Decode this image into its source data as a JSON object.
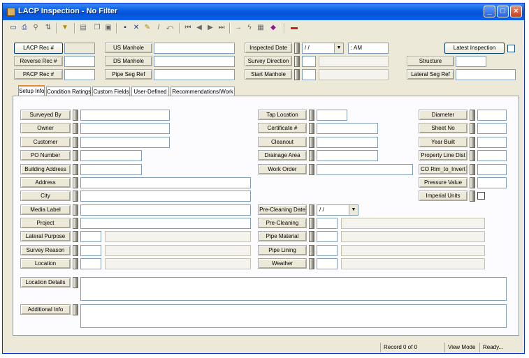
{
  "window": {
    "title": "LACP Inspection - No Filter"
  },
  "toolbar_icons": [
    "form-view-icon",
    "print-icon",
    "binoculars-icon",
    "sort-icon",
    "filter-icon",
    "report-icon",
    "copy-icon",
    "save-icon",
    "delete-icon",
    "edit-icon",
    "pencil-icon",
    "undo-icon",
    "first-record-icon",
    "prev-record-icon",
    "next-record-icon",
    "last-record-icon",
    "new-record-icon",
    "lightning-icon",
    "calculator-icon",
    "book-icon",
    "exit-icon"
  ],
  "header": {
    "lacp_rec": "LACP Rec #",
    "reverse_rec": "Reverse Rec #",
    "pacp_rec": "PACP Rec #",
    "us_manhole": "US Manhole",
    "ds_manhole": "DS Manhole",
    "pipe_seg_ref": "Pipe Seg Ref",
    "inspected_date": "Inspected Date",
    "inspected_date_value": "/ /",
    "inspected_time_value": ":  AM",
    "survey_direction": "Survey Direction",
    "start_manhole": "Start Manhole",
    "latest_inspection": "Latest Inspection",
    "structure": "Structure",
    "lateral_seg_ref": "Lateral Seg Ref"
  },
  "tabs": [
    "Setup Info",
    "Condition Ratings",
    "Custom Fields",
    "User-Defined",
    "Recommendations/Work"
  ],
  "left_fields": [
    "Surveyed By",
    "Owner",
    "Customer",
    "PO Number",
    "Building Address",
    "Address",
    "City",
    "Media Label",
    "Project",
    "Lateral Purpose",
    "Survey Reason",
    "Location"
  ],
  "mid_fields": [
    "Tap Location",
    "Certificate #",
    "Cleanout",
    "Drainage Area",
    "Work Order",
    "Pre-Cleaning Date",
    "Pre-Cleaning",
    "Pipe Material",
    "Pipe Lining",
    "Weather"
  ],
  "pre_cleaning_date_value": "/ /",
  "right_fields": [
    "Diameter",
    "Sheet No",
    "Year Built",
    "Property Line Dist",
    "CO Rim_to_Invert",
    "Pressure Value",
    "Imperial Units"
  ],
  "bottom_fields": [
    "Location Details",
    "Additional Info"
  ],
  "status": {
    "record": "Record 0 of 0",
    "mode": "View Mode",
    "state": "Ready..."
  }
}
